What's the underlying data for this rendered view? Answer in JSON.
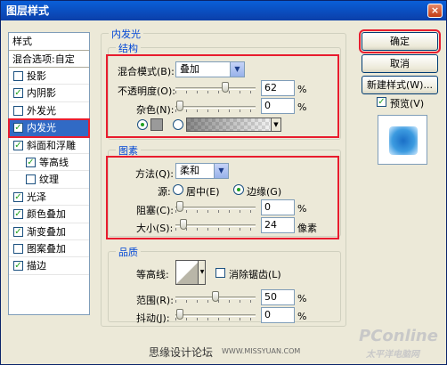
{
  "window": {
    "title": "图层样式",
    "close_glyph": "×"
  },
  "style_list": {
    "header": "样式",
    "blend_options": "混合选项:自定",
    "items": [
      {
        "label": "投影",
        "checked": false,
        "indent": false,
        "selected": false
      },
      {
        "label": "内阴影",
        "checked": true,
        "indent": false,
        "selected": false
      },
      {
        "label": "外发光",
        "checked": false,
        "indent": false,
        "selected": false
      },
      {
        "label": "内发光",
        "checked": true,
        "indent": false,
        "selected": true
      },
      {
        "label": "斜面和浮雕",
        "checked": true,
        "indent": false,
        "selected": false
      },
      {
        "label": "等高线",
        "checked": true,
        "indent": true,
        "selected": false
      },
      {
        "label": "纹理",
        "checked": false,
        "indent": true,
        "selected": false
      },
      {
        "label": "光泽",
        "checked": true,
        "indent": false,
        "selected": false
      },
      {
        "label": "颜色叠加",
        "checked": true,
        "indent": false,
        "selected": false
      },
      {
        "label": "渐变叠加",
        "checked": true,
        "indent": false,
        "selected": false
      },
      {
        "label": "图案叠加",
        "checked": false,
        "indent": false,
        "selected": false
      },
      {
        "label": "描边",
        "checked": true,
        "indent": false,
        "selected": false
      }
    ]
  },
  "panel": {
    "title": "内发光",
    "structure": {
      "title": "结构",
      "blend_mode_label": "混合模式(B):",
      "blend_mode_value": "叠加",
      "opacity_label": "不透明度(O):",
      "opacity_value": "62",
      "opacity_level": 0.62,
      "noise_label": "杂色(N):",
      "noise_value": "0",
      "noise_level": 0.0,
      "percent": "%"
    },
    "elements": {
      "title": "图素",
      "method_label": "方法(Q):",
      "method_value": "柔和",
      "source_label": "源:",
      "source_center": "居中(E)",
      "source_edge": "边缘(G)",
      "choke_label": "阻塞(C):",
      "choke_value": "0",
      "choke_level": 0.0,
      "size_label": "大小(S):",
      "size_value": "24",
      "size_level": 0.1,
      "percent": "%",
      "pixels": "像素"
    },
    "quality": {
      "title": "品质",
      "contour_label": "等高线:",
      "anti_alias_label": "消除锯齿(L)",
      "anti_alias_checked": false,
      "range_label": "范围(R):",
      "range_value": "50",
      "range_level": 0.5,
      "jitter_label": "抖动(J):",
      "jitter_value": "0",
      "jitter_level": 0.0,
      "percent": "%"
    }
  },
  "buttons": {
    "ok": "确定",
    "cancel": "取消",
    "new_style": "新建样式(W)...",
    "preview_label": "预览(V)",
    "preview_checked": true
  },
  "watermark": {
    "site": "思缘设计论坛",
    "url": "WWW.MISSYUAN.COM",
    "logo": "PConline",
    "logo_sub": "太平洋电脑网"
  },
  "colors": {
    "accent_red": "#e81c2e",
    "selection_blue": "#316ac5",
    "title_blue": "#0046d5",
    "check_green": "#21a121"
  }
}
